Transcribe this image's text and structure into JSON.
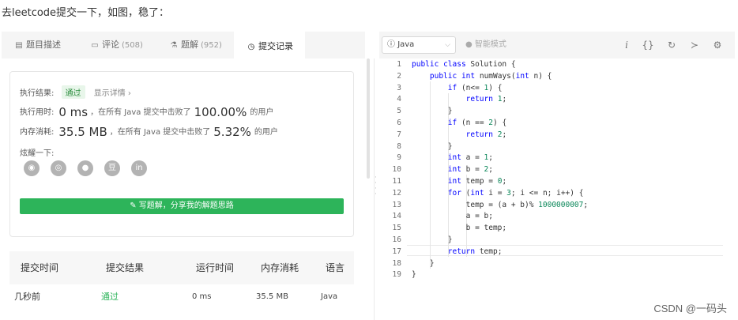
{
  "intro": "去leetcode提交一下，如图，稳了：",
  "tabs": [
    {
      "icon": "▤",
      "label": "题目描述",
      "count": ""
    },
    {
      "icon": "▭",
      "label": "评论",
      "count": "(508)"
    },
    {
      "icon": "⚗",
      "label": "题解",
      "count": "(952)"
    },
    {
      "icon": "◷",
      "label": "提交记录",
      "count": ""
    }
  ],
  "result": {
    "label": "执行结果:",
    "status": "通过",
    "detail": "显示详情 ›",
    "time_label": "执行用时:",
    "time_value": "0 ms",
    "time_text": "，在所有 Java 提交中击败了",
    "time_pct": "100.00%",
    "time_suffix": "的用户",
    "mem_label": "内存消耗:",
    "mem_value": "35.5 MB",
    "mem_text": "，在所有 Java 提交中击败了",
    "mem_pct": "5.32%",
    "mem_suffix": "的用户",
    "share_label": "炫耀一下:",
    "share_icons": [
      "wechat-icon",
      "weibo-icon",
      "qq-icon",
      "douban-icon",
      "linkedin-icon"
    ],
    "write_solution": "✎ 写题解，分享我的解题思路"
  },
  "table": {
    "headers": [
      "提交时间",
      "提交结果",
      "运行时间",
      "内存消耗",
      "语言"
    ],
    "rows": [
      [
        "几秒前",
        "通过",
        "0 ms",
        "35.5 MB",
        "Java"
      ]
    ]
  },
  "editor": {
    "language": "Java",
    "smart_mode": "智能模式",
    "tool_icons": [
      "info-icon",
      "braces-icon",
      "reset-icon",
      "console-icon",
      "settings-icon"
    ],
    "code": [
      "public class Solution {",
      "    public int numWays(int n) {",
      "        if (n<= 1) {",
      "            return 1;",
      "        }",
      "        if (n == 2) {",
      "            return 2;",
      "        }",
      "        int a = 1;",
      "        int b = 2;",
      "        int temp = 0;",
      "        for (int i = 3; i <= n; i++) {",
      "            temp = (a + b)% 1000000007;",
      "            a = b;",
      "            b = temp;",
      "        }",
      "        return temp;",
      "    }",
      "}"
    ]
  },
  "watermark": "CSDN @一码头",
  "colors": {
    "accent_green": "#2db45a",
    "keyword_blue": "#0000ff",
    "number_green": "#098658"
  }
}
